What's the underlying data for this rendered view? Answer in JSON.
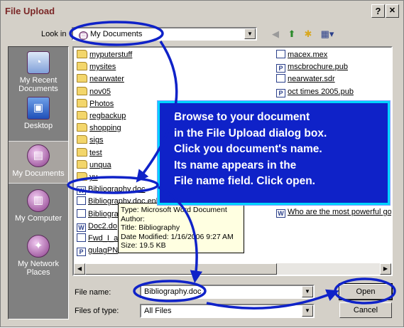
{
  "window": {
    "title": "File Upload",
    "help_label": "?",
    "close_label": "✕"
  },
  "lookin": {
    "label": "Look in",
    "value": "My Documents",
    "folder_glyph": "▤"
  },
  "toolbar": {
    "back_glyph": "◀",
    "up_glyph": "⬆",
    "newfolder_glyph": "✱",
    "views_glyph": "▦▾"
  },
  "places": [
    {
      "label": "My Recent Documents",
      "glyph": "◔"
    },
    {
      "label": "Desktop",
      "glyph": "▣"
    },
    {
      "label": "My Documents",
      "glyph": "▤"
    },
    {
      "label": "My Computer",
      "glyph": "▥"
    },
    {
      "label": "My Network Places",
      "glyph": "✦"
    }
  ],
  "files_left": [
    {
      "name": "myputerstuff",
      "kind": "folder"
    },
    {
      "name": "mysites",
      "kind": "folder"
    },
    {
      "name": "nearwater",
      "kind": "folder"
    },
    {
      "name": "nov05",
      "kind": "folder"
    },
    {
      "name": "Photos",
      "kind": "folder"
    },
    {
      "name": "regbackup",
      "kind": "folder"
    },
    {
      "name": "shopping",
      "kind": "folder"
    },
    {
      "name": "sigs",
      "kind": "folder"
    },
    {
      "name": "test",
      "kind": "folder"
    },
    {
      "name": "unqua",
      "kind": "folder"
    },
    {
      "name": "yu",
      "kind": "folder"
    },
    {
      "name": "Bibliography.doc",
      "kind": "doc",
      "glyph": "W"
    },
    {
      "name": "Bibliography.doc.enl",
      "kind": "doc",
      "glyph": ""
    },
    {
      "name": "Bibliogra",
      "kind": "doc",
      "glyph": ""
    },
    {
      "name": "Doc2.do",
      "kind": "doc",
      "glyph": "W"
    },
    {
      "name": "Fwd_I_a",
      "kind": "doc",
      "glyph": ""
    },
    {
      "name": "gulagPN",
      "kind": "doc",
      "glyph": "P"
    }
  ],
  "files_right": [
    {
      "name": "macex.mex",
      "kind": "doc",
      "glyph": ""
    },
    {
      "name": "mscbrochure.pub",
      "kind": "doc",
      "glyph": "P"
    },
    {
      "name": "nearwater.sdr",
      "kind": "doc",
      "glyph": ""
    },
    {
      "name": "oct times 2005.pub",
      "kind": "doc",
      "glyph": "P"
    },
    {
      "name": "Who are the most powerful go",
      "kind": "doc",
      "glyph": "W"
    }
  ],
  "tooltip": {
    "line1": "Type: Microsoft Word Document",
    "line2": "Author:",
    "line3": "Title: Bibliography",
    "line4": "Date Modified: 1/16/2006 9:27 AM",
    "line5": "Size: 19.5 KB"
  },
  "filename": {
    "label": "File name:",
    "value": "Bibliography.doc"
  },
  "filetype": {
    "label": "Files of type:",
    "value": "All Files"
  },
  "buttons": {
    "open": "Open",
    "cancel": "Cancel"
  },
  "callout": {
    "line1": "Browse to your document",
    "line2": "in the File Upload dialog box.",
    "line3": "Click you document's name.",
    "line4": "Its name appears in the",
    "line5": "File name field. Click open."
  },
  "colors": {
    "annotation_blue": "#0f22c8",
    "annotation_outline": "#00d4ff",
    "title_text": "#7a2626"
  }
}
